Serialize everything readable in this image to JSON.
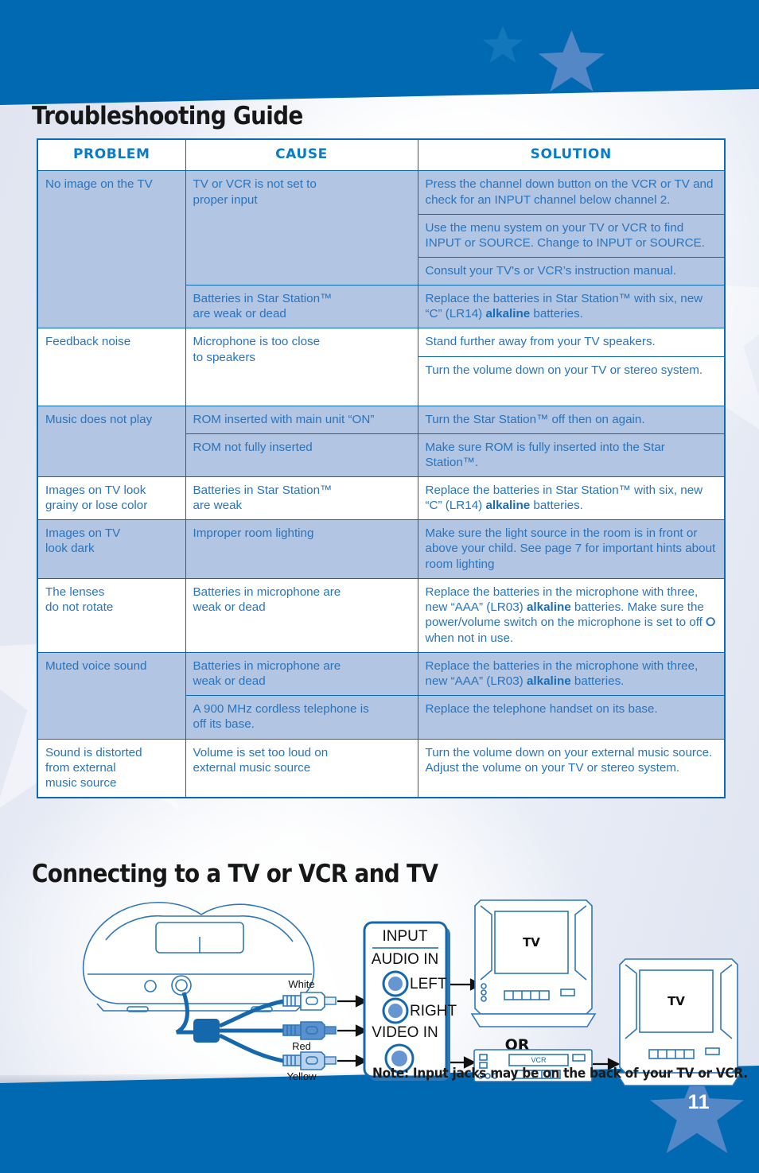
{
  "page": {
    "number": "11",
    "accent_blue": "#0069b1",
    "table_border": "#0c6ab4",
    "table_text": "#2a74bb",
    "shade_row": "#b2c5e3",
    "heading_color": "#171717"
  },
  "headings": {
    "troubleshooting": "Troubleshooting Guide",
    "connecting": "Connecting to a TV or VCR and TV"
  },
  "table": {
    "columns": [
      "PROBLEM",
      "CAUSE",
      "SOLUTION"
    ],
    "rows": [
      {
        "problem": "No image on the TV",
        "shaded": true,
        "causes": [
          {
            "cause": "TV or VCR is not set to\nproper input",
            "solutions": [
              "Press the channel down button on the VCR or TV and check for an INPUT channel below channel 2.",
              "Use the menu system on your TV or VCR to find INPUT or SOURCE. Change to INPUT or SOURCE.",
              "Consult your TV's or VCR’s instruction manual."
            ]
          },
          {
            "cause": "Batteries in Star Station™\nare weak or dead",
            "solutions": [
              "Replace the batteries in Star Station™ with six, new “C” (LR14) alkaline batteries."
            ]
          }
        ]
      },
      {
        "problem": "Feedback noise",
        "shaded": false,
        "causes": [
          {
            "cause": "Microphone is too close\nto speakers",
            "solutions": [
              "Stand further away from your TV speakers.",
              "Turn the volume down on your TV or stereo system."
            ]
          }
        ]
      },
      {
        "problem": "Music does not play",
        "shaded": true,
        "causes": [
          {
            "cause": "ROM inserted with main unit “ON”",
            "solutions": [
              "Turn the Star Station™ off then on again."
            ]
          },
          {
            "cause": "ROM not fully inserted",
            "solutions": [
              "Make sure ROM is fully inserted into the Star Station™."
            ]
          }
        ]
      },
      {
        "problem": "Images on TV look\ngrainy or lose color",
        "shaded": false,
        "causes": [
          {
            "cause": "Batteries in Star Station™\nare weak",
            "solutions": [
              "Replace the batteries in Star Station™ with six, new “C” (LR14) alkaline batteries."
            ]
          }
        ]
      },
      {
        "problem": "Images on TV\nlook dark",
        "shaded": true,
        "causes": [
          {
            "cause": "Improper room lighting",
            "solutions": [
              "Make sure the light source in the room is in front or above your child. See page 7 for important hints about room lighting"
            ]
          }
        ]
      },
      {
        "problem": "The lenses\ndo not rotate",
        "shaded": false,
        "causes": [
          {
            "cause": "Batteries in microphone are\nweak or dead",
            "solutions": [
              "Replace the batteries in the microphone with three, new “AAA” (LR03) alkaline batteries. Make sure the power/volume switch on the microphone is set to off ⭕ when not in use."
            ]
          }
        ]
      },
      {
        "problem": "Muted voice sound",
        "shaded": true,
        "causes": [
          {
            "cause": "Batteries in microphone are\nweak or dead",
            "solutions": [
              "Replace the batteries in the microphone with three, new “AAA” (LR03) alkaline batteries."
            ]
          },
          {
            "cause": "A 900 MHz cordless telephone is\noff its base.",
            "solutions": [
              "Replace the telephone handset on its base."
            ]
          }
        ]
      },
      {
        "problem": "Sound is distorted\nfrom external\nmusic source",
        "shaded": false,
        "causes": [
          {
            "cause": "Volume is set too loud on\nexternal music source",
            "solutions": [
              "Turn the volume down on your external music source. Adjust the volume on your TV or stereo system."
            ]
          }
        ]
      }
    ]
  },
  "diagram": {
    "panel_title": "INPUT",
    "audio_in_label": "AUDIO IN",
    "video_in_label": "VIDEO IN",
    "jack_left": "LEFT",
    "jack_right": "RIGHT",
    "plugs": [
      {
        "label": "White",
        "color": "#e8f1fb"
      },
      {
        "label": "Red",
        "color": "#5a90cd"
      },
      {
        "label": "Yellow",
        "color": "#b9d3ee"
      }
    ],
    "tv_label_1": "TV",
    "tv_label_2": "TV",
    "vcr_label": "VCR",
    "or_label": "OR",
    "note": "Note: Input jacks may be on the back of your TV or VCR."
  }
}
